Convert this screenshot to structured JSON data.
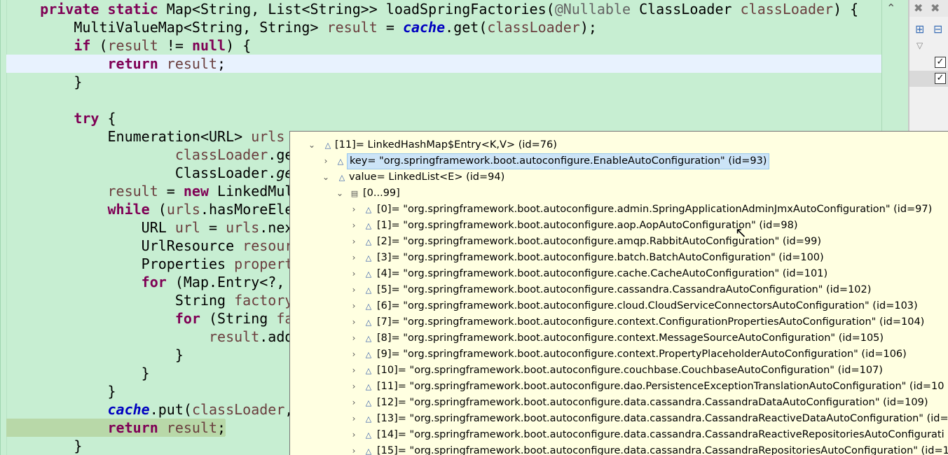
{
  "editor": {
    "lines": [
      {
        "parts": [
          [
            "kw",
            "private "
          ],
          [
            "kw",
            "static "
          ],
          [
            "ovr",
            "Map<String, List<String>> loadSpringFactories("
          ],
          [
            "ann",
            "@Nullable"
          ],
          [
            "ovr",
            " ClassLoader "
          ],
          [
            "var",
            "classLoader"
          ],
          [
            "ovr",
            ") {"
          ]
        ],
        "indent": "    "
      },
      {
        "parts": [
          [
            "ovr",
            "MultiValueMap<String, String> "
          ],
          [
            "var",
            "result"
          ],
          [
            "ovr",
            " = "
          ],
          [
            "fld",
            "cache"
          ],
          [
            "ovr",
            ".get("
          ],
          [
            "var",
            "classLoader"
          ],
          [
            "ovr",
            ");"
          ]
        ],
        "indent": "        "
      },
      {
        "parts": [
          [
            "kw",
            "if"
          ],
          [
            "ovr",
            " ("
          ],
          [
            "var",
            "result"
          ],
          [
            "ovr",
            " != "
          ],
          [
            "kw",
            "null"
          ],
          [
            "ovr",
            ") {"
          ]
        ],
        "indent": "        "
      },
      {
        "parts": [
          [
            "kw",
            "return "
          ],
          [
            "var",
            "result"
          ],
          [
            "ovr",
            ";"
          ]
        ],
        "indent": "            "
      },
      {
        "parts": [
          [
            "ovr",
            "}"
          ]
        ],
        "indent": "        "
      },
      {
        "parts": [],
        "indent": ""
      },
      {
        "parts": [
          [
            "kw",
            "try"
          ],
          [
            "ovr",
            " {"
          ]
        ],
        "indent": "        "
      },
      {
        "parts": [
          [
            "ovr",
            "Enumeration<URL> "
          ],
          [
            "var",
            "urls"
          ]
        ],
        "indent": "            "
      },
      {
        "parts": [
          [
            "var",
            "classLoader"
          ],
          [
            "ovr",
            ".ge"
          ]
        ],
        "indent": "                    "
      },
      {
        "parts": [
          [
            "ovr",
            "ClassLoader."
          ],
          [
            "ital",
            "ge"
          ]
        ],
        "indent": "                    "
      },
      {
        "parts": [
          [
            "var",
            "result"
          ],
          [
            "ovr",
            " = "
          ],
          [
            "kw",
            "new "
          ],
          [
            "ovr",
            "LinkedMul"
          ]
        ],
        "indent": "            "
      },
      {
        "parts": [
          [
            "kw",
            "while"
          ],
          [
            "ovr",
            " ("
          ],
          [
            "var",
            "urls"
          ],
          [
            "ovr",
            ".hasMoreEle"
          ]
        ],
        "indent": "            "
      },
      {
        "parts": [
          [
            "ovr",
            "URL "
          ],
          [
            "var",
            "url"
          ],
          [
            "ovr",
            " = "
          ],
          [
            "var",
            "urls"
          ],
          [
            "ovr",
            ".nex"
          ]
        ],
        "indent": "                "
      },
      {
        "parts": [
          [
            "ovr",
            "UrlResource "
          ],
          [
            "var",
            "resour"
          ]
        ],
        "indent": "                "
      },
      {
        "parts": [
          [
            "ovr",
            "Properties "
          ],
          [
            "var",
            "propert"
          ]
        ],
        "indent": "                "
      },
      {
        "parts": [
          [
            "kw",
            "for"
          ],
          [
            "ovr",
            " (Map.Entry<?, "
          ]
        ],
        "indent": "                "
      },
      {
        "parts": [
          [
            "ovr",
            "String "
          ],
          [
            "var",
            "factory"
          ]
        ],
        "indent": "                    "
      },
      {
        "parts": [
          [
            "kw",
            "for"
          ],
          [
            "ovr",
            " (String "
          ],
          [
            "var",
            "fa"
          ]
        ],
        "indent": "                    "
      },
      {
        "parts": [
          [
            "var",
            "result"
          ],
          [
            "ovr",
            ".add"
          ]
        ],
        "indent": "                        "
      },
      {
        "parts": [
          [
            "ovr",
            "}"
          ]
        ],
        "indent": "                    "
      },
      {
        "parts": [
          [
            "ovr",
            "}"
          ]
        ],
        "indent": "                "
      },
      {
        "parts": [
          [
            "ovr",
            "}"
          ]
        ],
        "indent": "            "
      },
      {
        "parts": [
          [
            "fld",
            "cache"
          ],
          [
            "ovr",
            ".put("
          ],
          [
            "var",
            "classLoader"
          ],
          [
            "ovr",
            ","
          ]
        ],
        "indent": "            "
      },
      {
        "parts": [
          [
            "kw",
            "return "
          ],
          [
            "var",
            "result"
          ],
          [
            "ovr",
            ";"
          ]
        ],
        "indent": "            "
      },
      {
        "parts": [
          [
            "ovr",
            "}"
          ]
        ],
        "indent": "        "
      }
    ]
  },
  "popup": {
    "entry_label": "[11]= LinkedHashMap$Entry<K,V>  (id=76)",
    "key_label": "key= \"org.springframework.boot.autoconfigure.EnableAutoConfiguration\" (id=93)",
    "value_label": "value= LinkedList<E>  (id=94)",
    "range_label": "[0...99]",
    "items": [
      "[0]= \"org.springframework.boot.autoconfigure.admin.SpringApplicationAdminJmxAutoConfiguration\" (id=97)",
      "[1]= \"org.springframework.boot.autoconfigure.aop.AopAutoConfiguration\" (id=98)",
      "[2]= \"org.springframework.boot.autoconfigure.amqp.RabbitAutoConfiguration\" (id=99)",
      "[3]= \"org.springframework.boot.autoconfigure.batch.BatchAutoConfiguration\" (id=100)",
      "[4]= \"org.springframework.boot.autoconfigure.cache.CacheAutoConfiguration\" (id=101)",
      "[5]= \"org.springframework.boot.autoconfigure.cassandra.CassandraAutoConfiguration\" (id=102)",
      "[6]= \"org.springframework.boot.autoconfigure.cloud.CloudServiceConnectorsAutoConfiguration\" (id=103)",
      "[7]= \"org.springframework.boot.autoconfigure.context.ConfigurationPropertiesAutoConfiguration\" (id=104)",
      "[8]= \"org.springframework.boot.autoconfigure.context.MessageSourceAutoConfiguration\" (id=105)",
      "[9]= \"org.springframework.boot.autoconfigure.context.PropertyPlaceholderAutoConfiguration\" (id=106)",
      "[10]= \"org.springframework.boot.autoconfigure.couchbase.CouchbaseAutoConfiguration\" (id=107)",
      "[11]= \"org.springframework.boot.autoconfigure.dao.PersistenceExceptionTranslationAutoConfiguration\" (id=10",
      "[12]= \"org.springframework.boot.autoconfigure.data.cassandra.CassandraDataAutoConfiguration\" (id=109)",
      "[13]= \"org.springframework.boot.autoconfigure.data.cassandra.CassandraReactiveDataAutoConfiguration\" (id=1",
      "[14]= \"org.springframework.boot.autoconfigure.data.cassandra.CassandraReactiveRepositoriesAutoConfigurati",
      "[15]= \"org.springframework.boot.autoconfigure.data.cassandra.CassandraRepositoriesAutoConfiguration\" (id=1"
    ]
  },
  "icons": {
    "collapse": "chevron-up-icon",
    "close_all": "close-all-icon",
    "expand_all": "expand-all-icon",
    "collapse_all": "collapse-all-icon",
    "menu": "view-menu-icon"
  },
  "colors": {
    "editor_bg": "#c7eed2",
    "popup_bg": "#ffffe1",
    "keyword": "#7f0055",
    "field": "#0000c0"
  }
}
